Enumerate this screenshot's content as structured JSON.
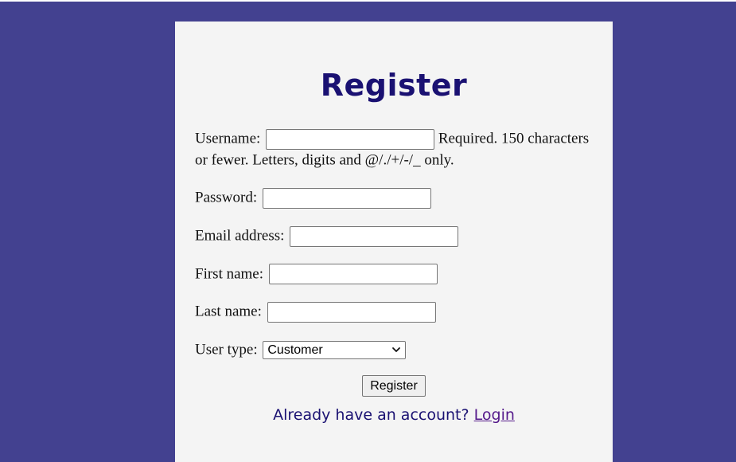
{
  "page": {
    "title": "Register"
  },
  "form": {
    "username": {
      "label": "Username:",
      "value": "",
      "help": "Required. 150 characters or fewer. Letters, digits and @/./+/-/_ only."
    },
    "password": {
      "label": "Password:",
      "value": ""
    },
    "email": {
      "label": "Email address:",
      "value": ""
    },
    "first_name": {
      "label": "First name:",
      "value": ""
    },
    "last_name": {
      "label": "Last name:",
      "value": ""
    },
    "user_type": {
      "label": "User type:",
      "selected": "Customer",
      "icon": "chevron-down-icon"
    },
    "submit_label": "Register"
  },
  "footer": {
    "prompt": "Already have an account?",
    "link_label": "Login"
  },
  "colors": {
    "background": "#434190",
    "card": "#f4f4f4",
    "heading": "#1a1172",
    "link": "#551a8b"
  }
}
